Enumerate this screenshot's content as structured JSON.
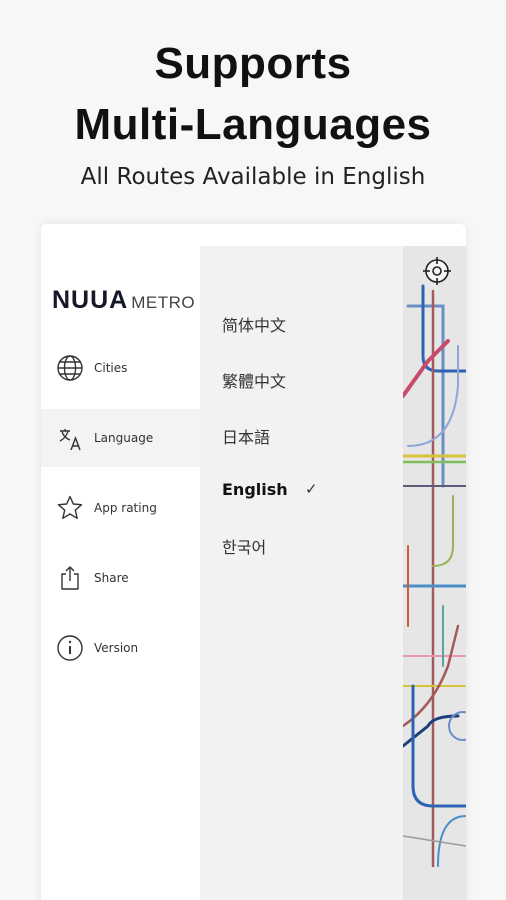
{
  "hero": {
    "title_line1": "Supports",
    "title_line2": "Multi-Languages",
    "subtitle": "All Routes Available in English"
  },
  "app": {
    "logo_brand": "NUUA",
    "logo_sub": "METRO"
  },
  "menu": [
    {
      "label": "Cities",
      "icon": "globe-icon",
      "active": false
    },
    {
      "label": "Language",
      "icon": "translate-icon",
      "active": true
    },
    {
      "label": "App rating",
      "icon": "star-icon",
      "active": false
    },
    {
      "label": "Share",
      "icon": "share-icon",
      "active": false
    },
    {
      "label": "Version",
      "icon": "info-icon",
      "active": false
    }
  ],
  "languages": [
    {
      "label": "简体中文",
      "selected": false
    },
    {
      "label": "繁體中文",
      "selected": false
    },
    {
      "label": "日本語",
      "selected": false
    },
    {
      "label": "English",
      "selected": true
    },
    {
      "label": "한국어",
      "selected": false
    }
  ],
  "check_mark": "✓",
  "colors": {
    "background": "#f7f7f8",
    "active_menu": "#f3f3f3",
    "language_panel": "#f2f2f2",
    "map_background": "#e6e6e6"
  }
}
